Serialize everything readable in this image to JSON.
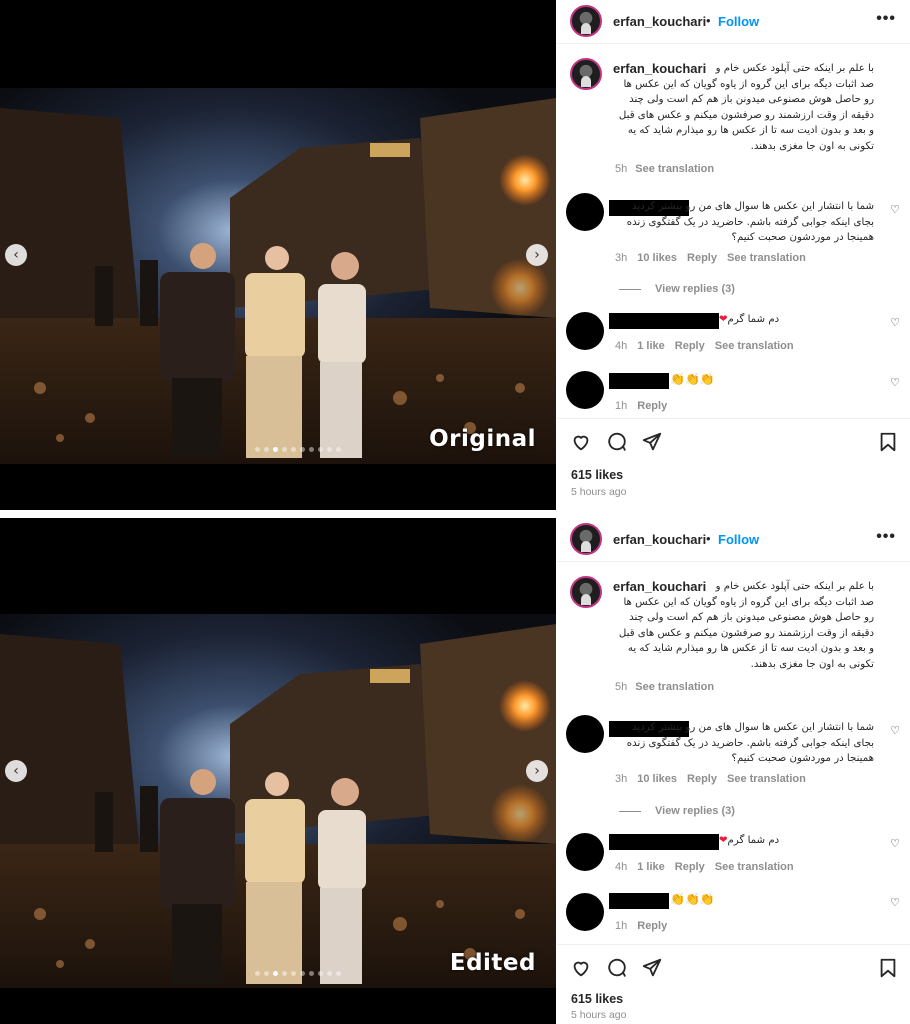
{
  "posts": [
    {
      "id": "original",
      "stamp": "Original",
      "header": {
        "username": "erfan_kouchari",
        "separator": "•",
        "follow": "Follow",
        "more": "•••"
      },
      "caption": {
        "username": "erfan_kouchari",
        "text": "با علم بر اینکه حتی آپلود عکس خام و صد اثبات دیگه برای این گروه از یاوه گویان که این عکس ها رو حاصل هوش مصنوعی میدونن باز هم کم است ولی چند دقیقه از وقت ارزشمند رو صرفشون میکنم و عکس های قبل و بعد و بدون ادیت سه تا از عکس ها رو میذارم شاید که یه تکونی به اون جا مغزی بدهند.",
        "time": "5h",
        "see_translation": "See translation"
      },
      "comments": [
        {
          "text": "شما با انتشار این عکس ها سوال های من رو بیشتر کردید بجای اینکه جوابی گرفته باشم. حاضرید در یک گفتگوی زنده همینجا در موردشون صحبت کنیم؟",
          "time": "3h",
          "likes": "10 likes",
          "reply": "Reply",
          "see_translation": "See translation",
          "view_replies": "View replies (3)"
        },
        {
          "text": "دم شما گرم",
          "emoji": "❤",
          "time": "4h",
          "likes": "1 like",
          "reply": "Reply",
          "see_translation": "See translation"
        },
        {
          "text": "",
          "emoji": "👏👏👏",
          "time": "1h",
          "reply": "Reply"
        }
      ],
      "likes": "615 likes",
      "ago": "5 hours ago"
    },
    {
      "id": "edited",
      "stamp": "Edited",
      "header": {
        "username": "erfan_kouchari",
        "separator": "•",
        "follow": "Follow",
        "more": "•••"
      },
      "caption": {
        "username": "erfan_kouchari",
        "text": "با علم بر اینکه حتی آپلود عکس خام و صد اثبات دیگه برای این گروه از یاوه گویان که این عکس ها رو حاصل هوش مصنوعی میدونن باز هم کم است ولی چند دقیقه از وقت ارزشمند رو صرفشون میکنم و عکس های قبل و بعد و بدون ادیت سه تا از عکس ها رو میذارم شاید که یه تکونی به اون جا مغزی بدهند.",
        "time": "5h",
        "see_translation": "See translation"
      },
      "comments": [
        {
          "text": "شما با انتشار این عکس ها سوال های من رو بیشتر کردید بجای اینکه جوابی گرفته باشم. حاضرید در یک گفتگوی زنده همینجا در موردشون صحبت کنیم؟",
          "time": "3h",
          "likes": "10 likes",
          "reply": "Reply",
          "see_translation": "See translation",
          "view_replies": "View replies (3)"
        },
        {
          "text": "دم شما گرم",
          "emoji": "❤",
          "time": "4h",
          "likes": "1 like",
          "reply": "Reply",
          "see_translation": "See translation"
        },
        {
          "text": "",
          "emoji": "👏👏👏",
          "time": "1h",
          "reply": "Reply"
        }
      ],
      "likes": "615 likes",
      "ago": "5 hours ago"
    }
  ],
  "nav": {
    "prev": "‹",
    "next": "›"
  },
  "icons": [
    "heart-icon",
    "comment-icon",
    "share-icon",
    "bookmark-icon",
    "more-icon",
    "chevron-left-icon",
    "chevron-right-icon"
  ],
  "colors": {
    "follow": "#0095f6",
    "muted": "#8e8e8e",
    "avatar_ring": "#c13584",
    "heart": "#ed1b3a"
  }
}
